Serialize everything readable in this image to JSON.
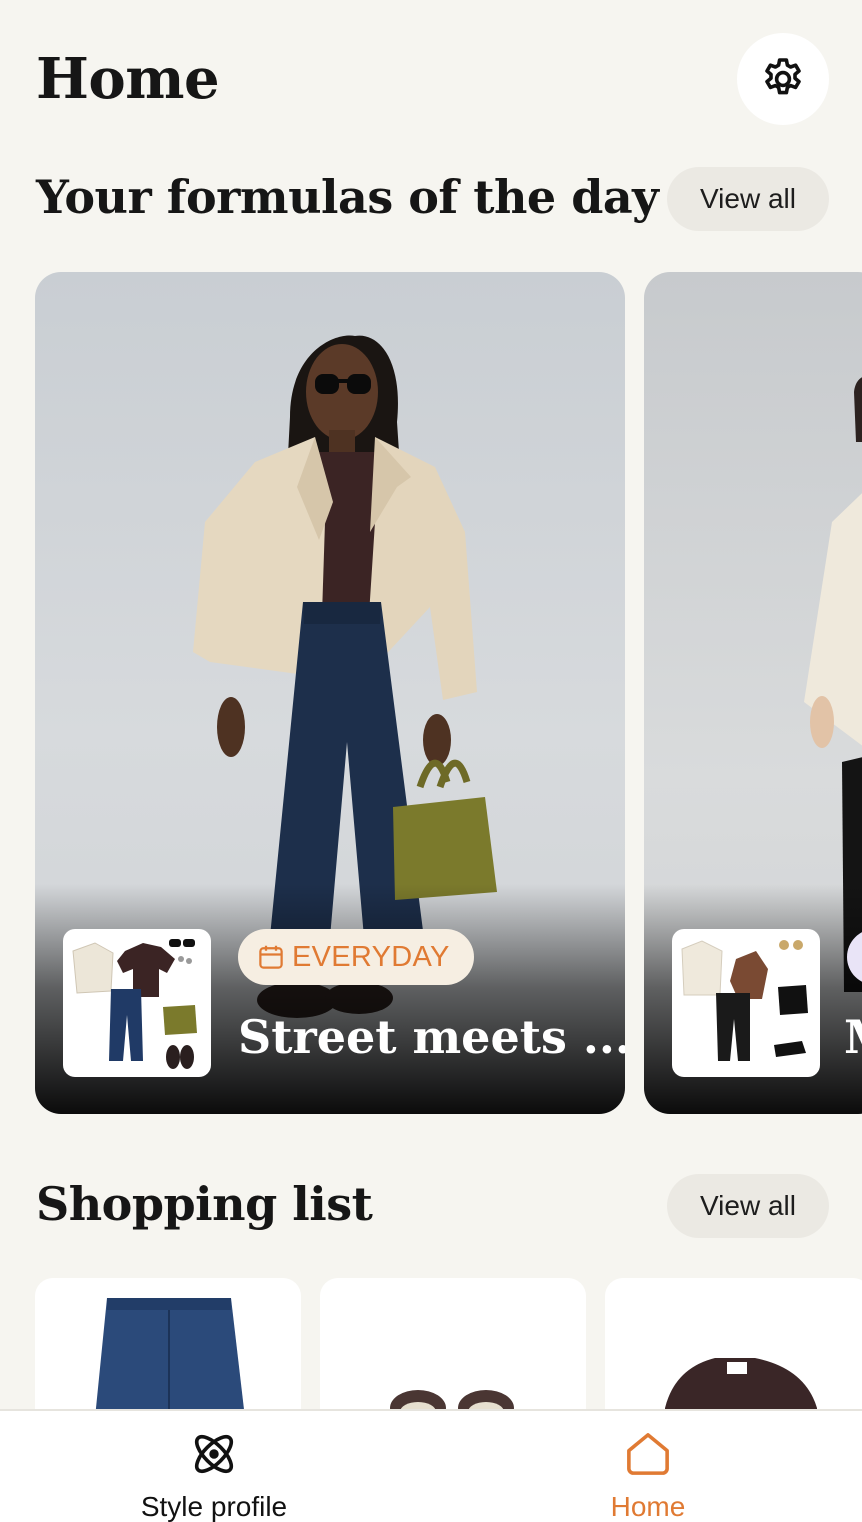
{
  "header": {
    "title": "Home",
    "settings_icon": "gear-icon"
  },
  "formulas": {
    "title": "Your formulas of the day",
    "view_all_label": "View all",
    "cards": [
      {
        "tag_icon": "calendar-icon",
        "tag_label": "EVERYDAY",
        "title": "Street meets ..."
      },
      {
        "title": "M"
      }
    ]
  },
  "shopping": {
    "title": "Shopping list",
    "view_all_label": "View all"
  },
  "nav": {
    "items": [
      {
        "label": "Style profile",
        "icon": "atom-icon",
        "active": false
      },
      {
        "label": "Home",
        "icon": "home-icon",
        "active": true
      }
    ]
  },
  "colors": {
    "background": "#f6f5f0",
    "accent": "#e07a33",
    "tag_background": "#f6eee2"
  }
}
